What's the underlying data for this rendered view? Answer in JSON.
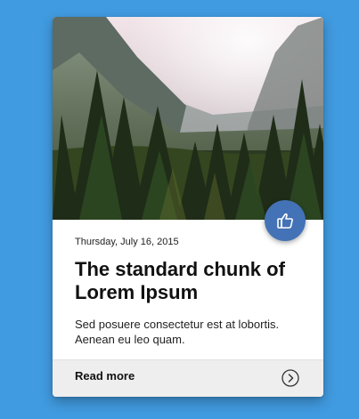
{
  "card": {
    "date": "Thursday, July 16, 2015",
    "title": "The standard chunk of Lorem Ipsum",
    "description": "Sed posuere consectetur est at lobortis. Aenean eu leo quam.",
    "read_more_label": "Read more"
  },
  "icons": {
    "like": "thumbs-up-icon",
    "arrow": "chevron-right-circle-icon"
  },
  "colors": {
    "background": "#419be0",
    "like_button": "#4372b6",
    "footer": "#eeeeee"
  }
}
